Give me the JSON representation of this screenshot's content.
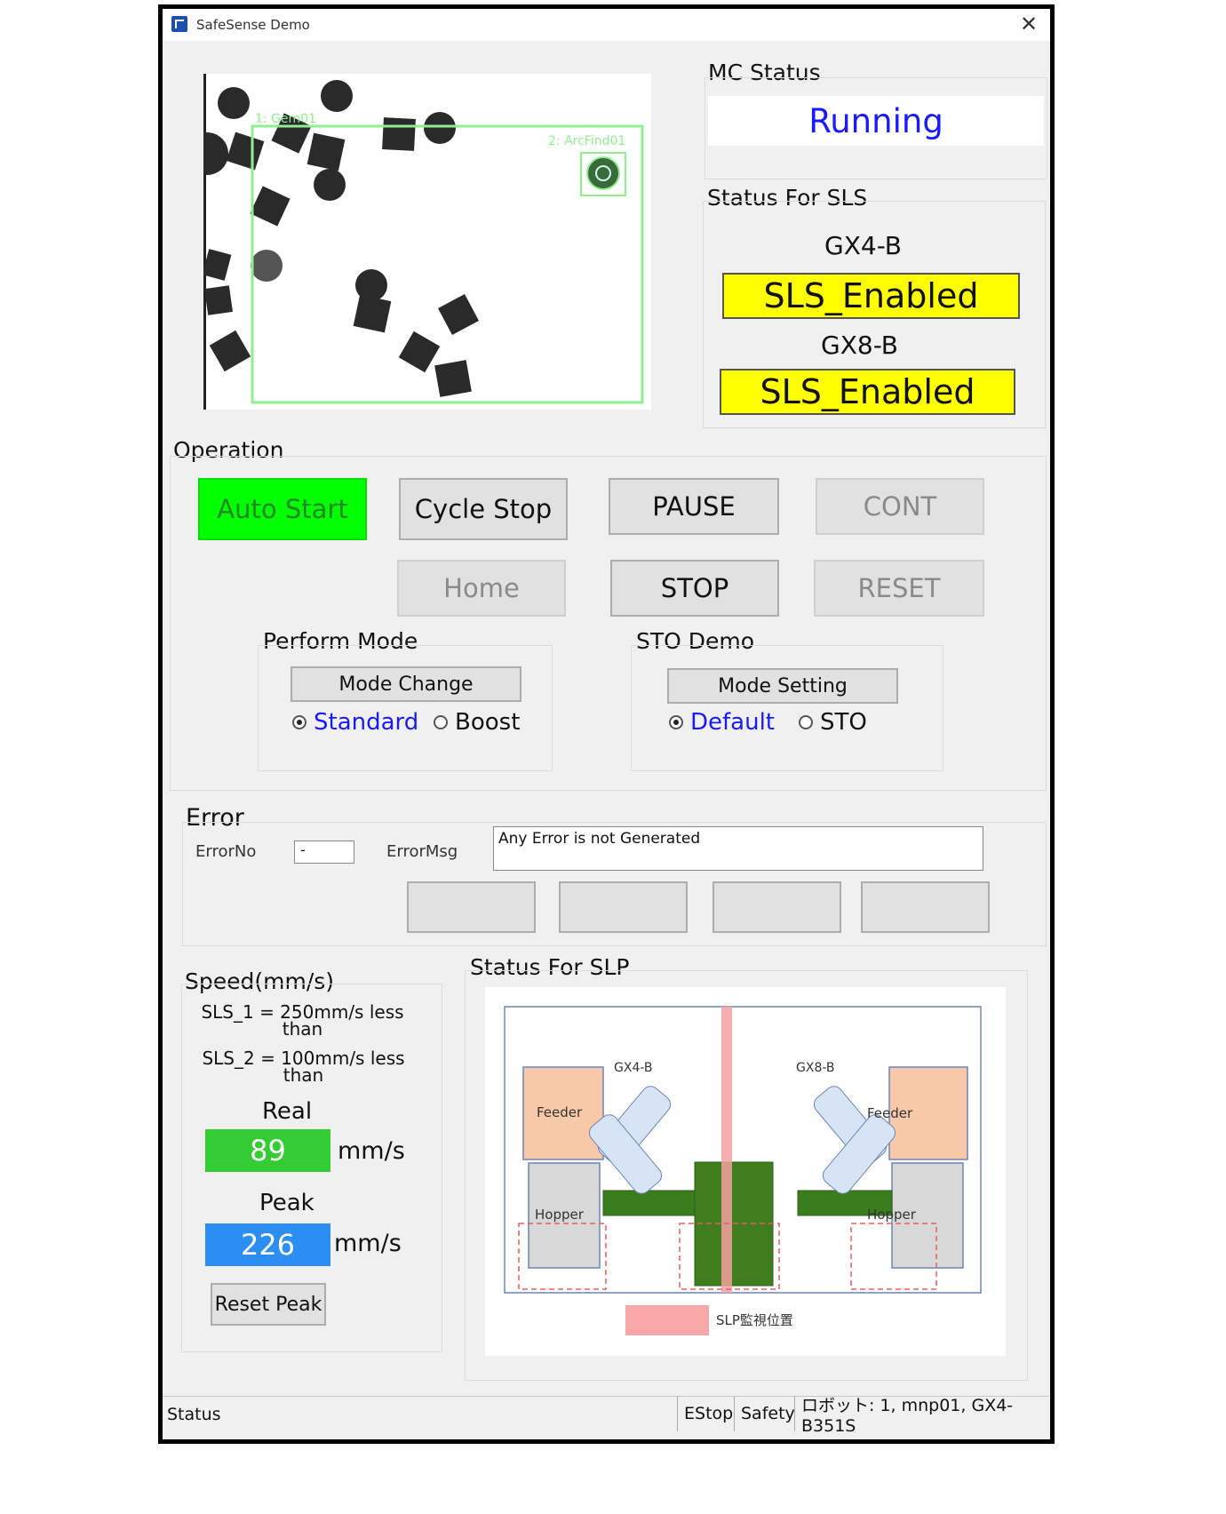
{
  "window": {
    "title": "SafeSense Demo"
  },
  "camera": {
    "labels": {
      "gem": "1: Gem01",
      "arc": "2: ArcFind01"
    }
  },
  "mc_status": {
    "label": "MC Status",
    "value": "Running"
  },
  "sls_status": {
    "label": "Status For SLS",
    "robot1": "GX4-B",
    "value1": "SLS_Enabled",
    "robot2": "GX8-B",
    "value2": "SLS_Enabled"
  },
  "operation": {
    "label": "Operation",
    "auto_start": "Auto Start",
    "cycle_stop": "Cycle Stop",
    "pause": "PAUSE",
    "cont": "CONT",
    "home": "Home",
    "stop": "STOP",
    "reset": "RESET"
  },
  "perform_mode": {
    "label": "Perform Mode",
    "button": "Mode Change",
    "option1": "Standard",
    "option2": "Boost",
    "selected": "Standard"
  },
  "sto_demo": {
    "label": "STO Demo",
    "button": "Mode Setting",
    "option1": "Default",
    "option2": "STO",
    "selected": "Default"
  },
  "error": {
    "label": "Error",
    "no_label": "ErrorNo",
    "no_value": "-",
    "msg_label": "ErrorMsg",
    "msg_value": "Any Error is not Generated"
  },
  "speed": {
    "label": "Speed(mm/s)",
    "sls1_a": "SLS_1 = 250mm/s less",
    "sls1_b": "than",
    "sls2_a": "SLS_2 = 100mm/s less",
    "sls2_b": "than",
    "real_label": "Real",
    "real_value": "89",
    "real_unit": "mm/s",
    "peak_label": "Peak",
    "peak_value": "226",
    "peak_unit": "mm/s",
    "reset_button": "Reset Peak"
  },
  "slp": {
    "label": "Status For SLP",
    "robot_left": "GX4-B",
    "robot_right": "GX8-B",
    "feeder": "Feeder",
    "hopper": "Hopper",
    "legend": "SLP監視位置"
  },
  "statusbar": {
    "status": "Status",
    "estop": "EStop",
    "safety": "Safety",
    "robot": "ロボット: 1, mnp01, GX4-B351S"
  },
  "colors": {
    "running": "#1a1aff",
    "sls": "#ffff00",
    "auto_start": "#00ff00",
    "real": "#33cc33",
    "peak": "#2b8ef0",
    "radio_selected": "#1a1aff"
  }
}
